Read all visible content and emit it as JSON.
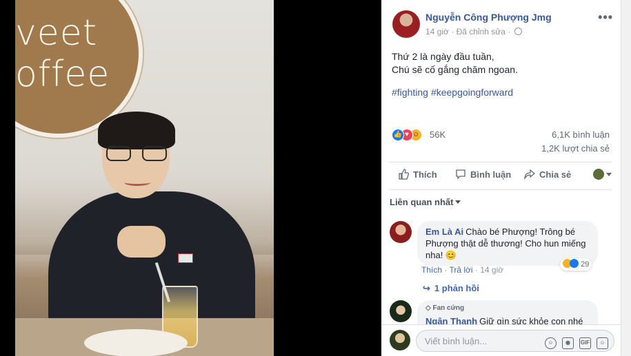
{
  "photo": {
    "logo_text": "veet\noffee"
  },
  "post": {
    "author": "Nguyễn Công Phượng Jmg",
    "time": "14 giờ",
    "edited": "Đã chỉnh sửa",
    "text_line1": "Thứ 2 là ngày đầu tuần,",
    "text_line2": "Chú sẽ cố gắng chăm ngoan.",
    "hashtags": [
      "#fighting",
      "#keepgoingforward"
    ],
    "reaction_count": "56K",
    "comment_count": "6,1K bình luận",
    "share_count": "1,2K lượt chia sẻ"
  },
  "actions": {
    "like": "Thích",
    "comment": "Bình luận",
    "share": "Chia sẻ"
  },
  "sort_label": "Liên quan nhất",
  "comments": [
    {
      "name": "Em Là Ai",
      "text": "Chào bé Phượng! Trông bé Phượng thật dễ thương! Cho hun miếng nha! 😊",
      "like": "Thích",
      "reply": "Trả lời",
      "time": "14 giờ",
      "reactions": "29",
      "replies": "1 phản hồi"
    },
    {
      "badge": "Fan cứng",
      "name": "Ngân Thanh",
      "text": "Giữ gìn sức khỏe con nhé cả"
    }
  ],
  "composer": {
    "placeholder": "Viết bình luận..."
  },
  "colors": {
    "link": "#385898",
    "like_blue": "#1877f2",
    "love_red": "#f33e58",
    "haha_yellow": "#f7b125"
  }
}
